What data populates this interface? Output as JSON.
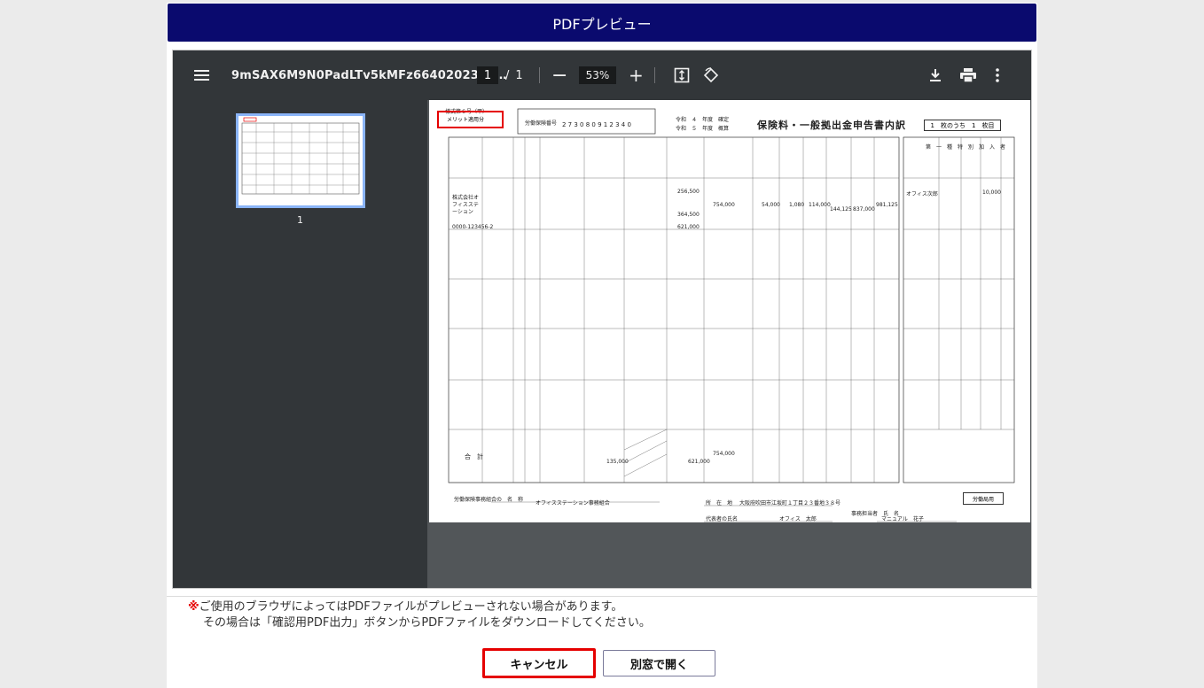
{
  "dialog": {
    "title": "PDFプレビュー"
  },
  "viewer": {
    "filename": "9mSAX6M9N0PadLTv5kMFz6640202306…",
    "page_current": "1",
    "page_sep": "/",
    "page_total": "1",
    "zoom": "53%",
    "zoom_out": "−",
    "zoom_in": "+",
    "thumb_label": "1",
    "icons": [
      "menu-icon",
      "fit-page-icon",
      "rotate-icon",
      "download-icon",
      "print-icon",
      "more-vert-icon"
    ]
  },
  "document": {
    "form_no": "様式第６号（甲）",
    "merit": "メリット適用分",
    "insurance_no_label": "労働保険番号",
    "insurance_no": "2 7 3 0 8 0 9 1 2 3 4 0",
    "year_top": "令和　４　年度　確定",
    "year_bottom": "令和　５　年度　概算",
    "title": "保険料・一般拠出金申告書内訳",
    "page_of": "1　枚のうち　1　枚目",
    "company": "株式会社オフィスステーション",
    "company_no": "0000-123456-2",
    "person": "オフィス次郎",
    "amount_1": "256,500",
    "amount_2": "754,000",
    "amount_3": "364,500",
    "amount_4": "621,000",
    "amount_5": "54,000",
    "amount_6": "1,080",
    "amount_7": "114,000",
    "amount_8": "144,125",
    "amount_9": "837,000",
    "amount_10": "981,125",
    "amount_11": "10,000",
    "total_label": "合　計",
    "total_a": "135,000",
    "total_b": "621,000",
    "total_c": "754,000",
    "association_label": "労働保険事務組合の　名　称",
    "association": "オフィスステーション事務組合",
    "address_label": "所　在　地",
    "address": "大阪府吹田市江坂町１丁目２３番地３８号",
    "rep_label": "代表者の氏名",
    "rep": "オフィス　太郎",
    "staff_label": "事務担当者　氏　名",
    "staff": "マニュアル　花子",
    "rosai": "労働局用",
    "special": "第　一　種　特　別　加　入　者"
  },
  "notice": {
    "mark": "※",
    "line1": "ご使用のブラウザによってはPDFファイルがプレビューされない場合があります。",
    "line2": "その場合は「確認用PDF出力」ボタンからPDFファイルをダウンロードしてください。"
  },
  "buttons": {
    "cancel": "キャンセル",
    "open_new": "別窓で開く"
  },
  "colors": {
    "header_bg": "#0a0a6e",
    "toolbar_bg": "#323639",
    "viewer_bg": "#525659",
    "highlight": "#e50000",
    "thumb_border": "#8ab4f8"
  }
}
